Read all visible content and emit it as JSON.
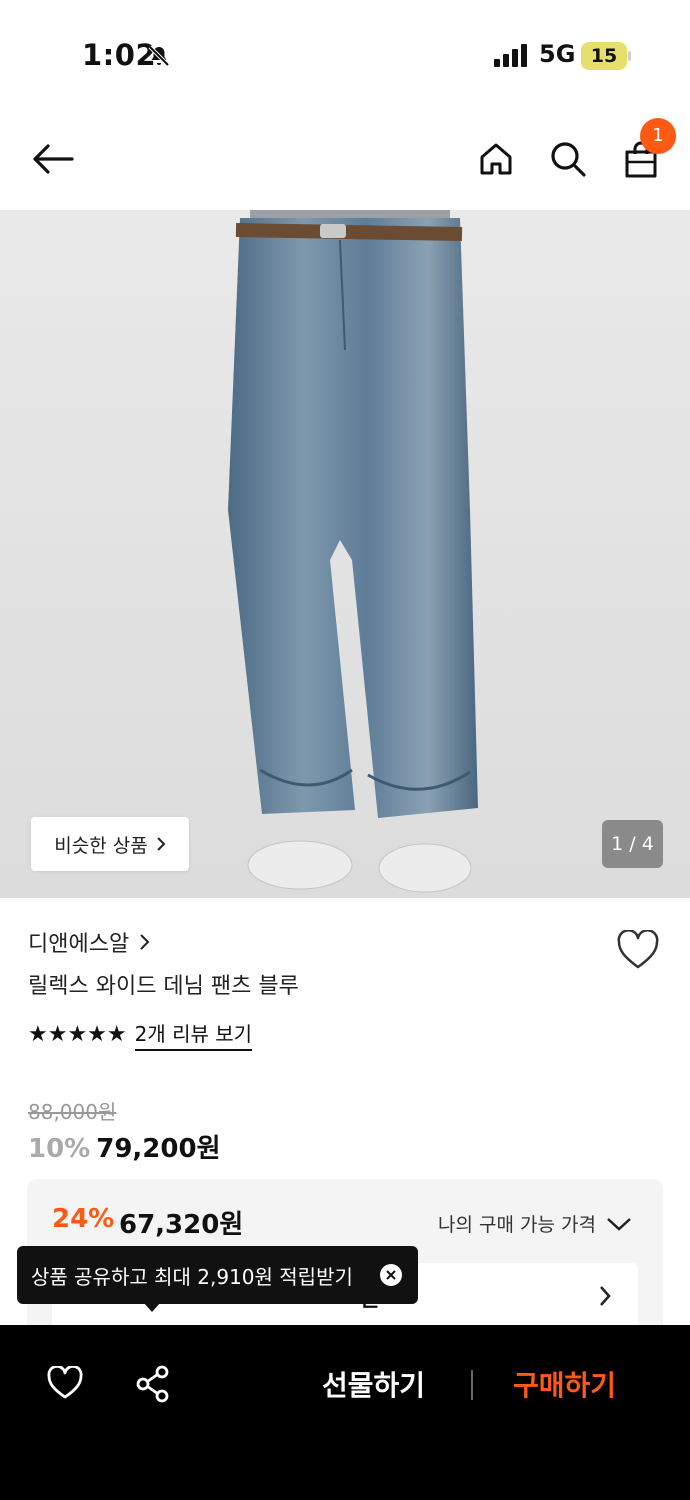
{
  "status_bar": {
    "time": "1:02",
    "network": "5G",
    "battery": "15"
  },
  "header": {
    "cart_count": "1"
  },
  "gallery": {
    "similar_label": "비슷한 상품",
    "counter": "1 / 4"
  },
  "product": {
    "brand": "디앤에스알",
    "name": "릴렉스 와이드 데님 팬츠 블루",
    "stars": "★★★★★",
    "review_link": "2개 리뷰 보기",
    "original_price": "88,000원",
    "discount_rate": "10%",
    "sale_price": "79,200원"
  },
  "my_price": {
    "rate": "24%",
    "price": "67,320원",
    "label": "나의 구매 가능 가격",
    "coupon_text": "원"
  },
  "tooltip": {
    "text": "상품 공유하고 최대 2,910원 적립받기"
  },
  "bottom_bar": {
    "gift_label": "선물하기",
    "buy_label": "구매하기"
  },
  "colors": {
    "accent": "#ff5a13",
    "bottom_bar": "#000000"
  }
}
